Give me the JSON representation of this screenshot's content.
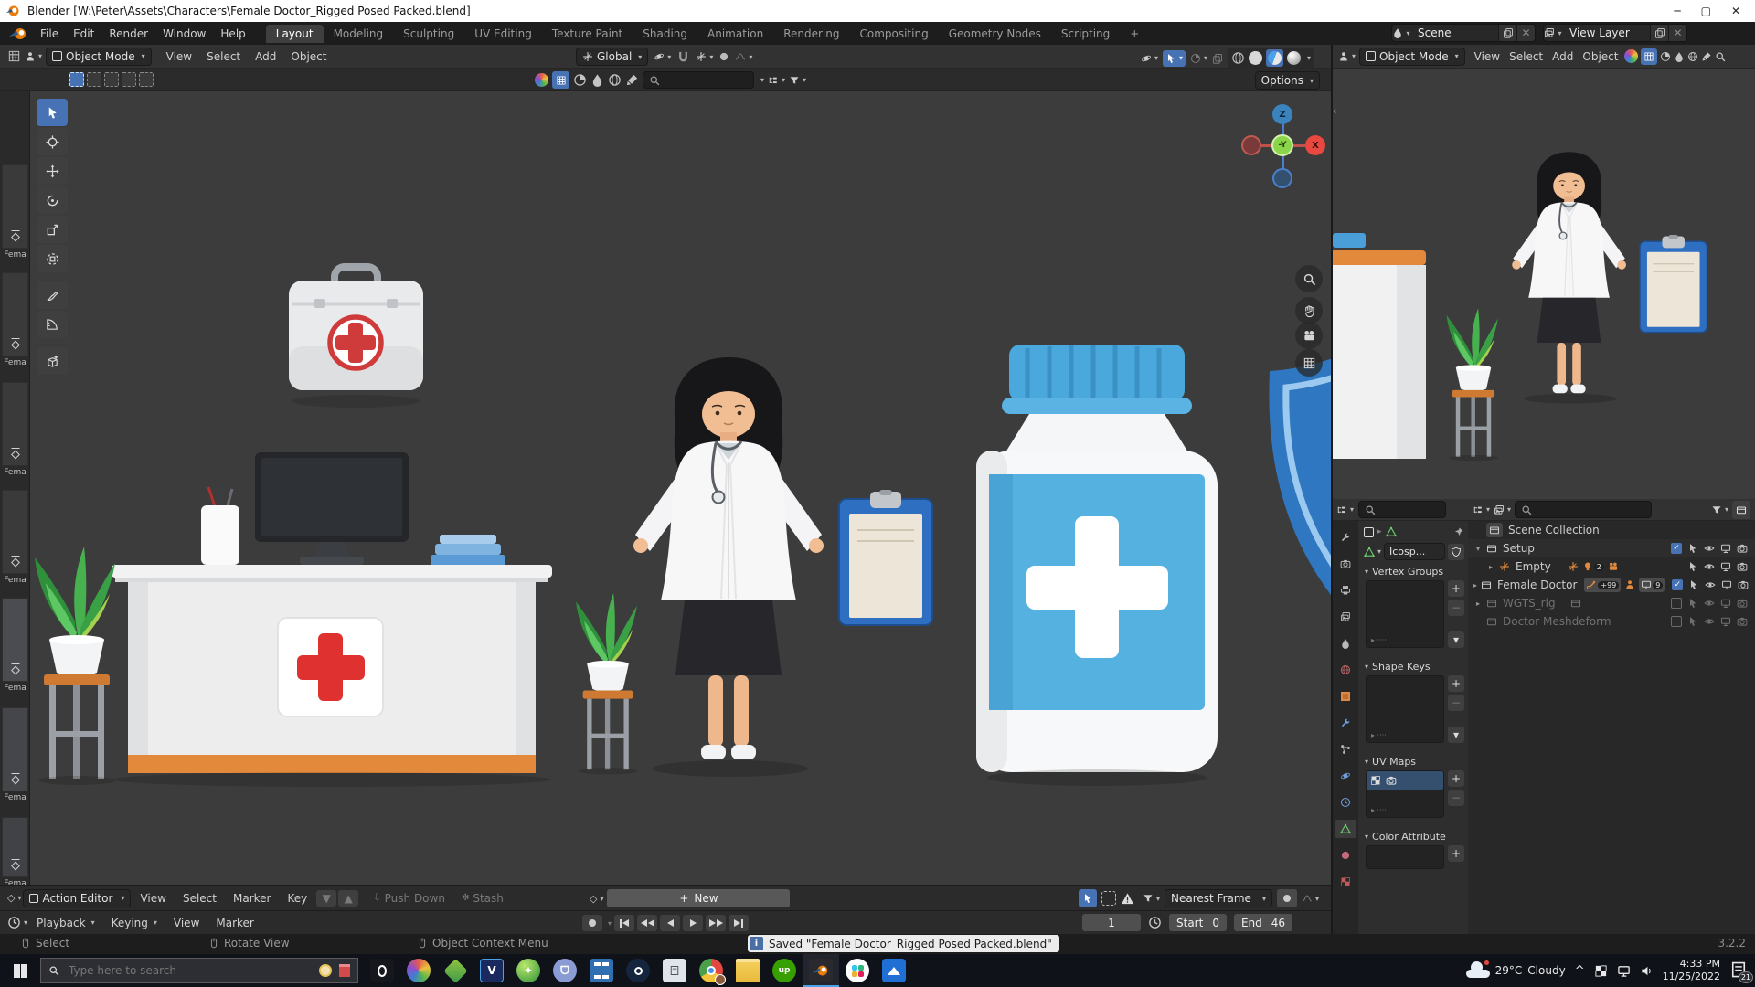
{
  "colors": {
    "accent": "#4772b3",
    "blender_orange": "#e87d0d",
    "viewport_bg": "#3c3c3c",
    "header_bg": "#323232",
    "topbar_bg": "#1d1d1d",
    "red_cross": "#d23b3b",
    "bottle_blue": "#55b1e0"
  },
  "window": {
    "title": "Blender [W:\\Peter\\Assets\\Characters\\Female Doctor_Rigged Posed Packed.blend]"
  },
  "topbar": {
    "menus": [
      "File",
      "Edit",
      "Render",
      "Window",
      "Help"
    ],
    "workspaces": [
      "Layout",
      "Modeling",
      "Sculpting",
      "UV Editing",
      "Texture Paint",
      "Shading",
      "Animation",
      "Rendering",
      "Compositing",
      "Geometry Nodes",
      "Scripting"
    ],
    "add_tab": "+",
    "scene_label": "Scene",
    "view_layer_label": "View Layer"
  },
  "viewport": {
    "mode": "Object Mode",
    "menu_view": "View",
    "menu_select": "Select",
    "menu_add": "Add",
    "menu_object": "Object",
    "orientation": "Global",
    "options": "Options"
  },
  "viewport2": {
    "mode": "Object Mode",
    "menu_view": "View",
    "menu_select": "Select",
    "menu_add": "Add",
    "menu_object": "Object"
  },
  "gizmo": {
    "z": "Z",
    "x": "X",
    "neg_y": "-Y"
  },
  "asset_strip": {
    "item_label": "Fema"
  },
  "properties": {
    "datablock": "Icosp...",
    "panel_vertex_groups": "Vertex Groups",
    "panel_shape_keys": "Shape Keys",
    "panel_uv_maps": "UV Maps",
    "panel_color_attribute": "Color Attribute"
  },
  "outliner": {
    "rows": [
      {
        "label": "Scene Collection"
      },
      {
        "label": "Setup"
      },
      {
        "label": "Empty",
        "count": "2"
      },
      {
        "label": "Female Doctor",
        "count": "+99",
        "count2": "9"
      },
      {
        "label": "WGTS_rig"
      },
      {
        "label": "Doctor Meshdeform"
      }
    ]
  },
  "dopesheet": {
    "editor": "Action Editor",
    "menu_view": "View",
    "menu_select": "Select",
    "menu_marker": "Marker",
    "menu_key": "Key",
    "push_down": "Push Down",
    "stash": "Stash",
    "new_action": "New",
    "snap": "Nearest Frame"
  },
  "timeline": {
    "menu_playback": "Playback",
    "menu_keying": "Keying",
    "menu_view": "View",
    "menu_marker": "Marker",
    "frame": "1",
    "start_label": "Start",
    "start": "0",
    "end_label": "End",
    "end": "46"
  },
  "statusbar": {
    "hint_select": "Select",
    "hint_rotate": "Rotate View",
    "hint_context": "Object Context Menu",
    "saved": "Saved \"Female Doctor_Rigged Posed Packed.blend\"",
    "version": "3.2.2"
  },
  "taskbar": {
    "search_placeholder": "Type here to search",
    "weather_temp": "29°C",
    "weather_cond": "Cloudy",
    "time": "4:33 PM",
    "date": "11/25/2022",
    "badge": "21"
  }
}
